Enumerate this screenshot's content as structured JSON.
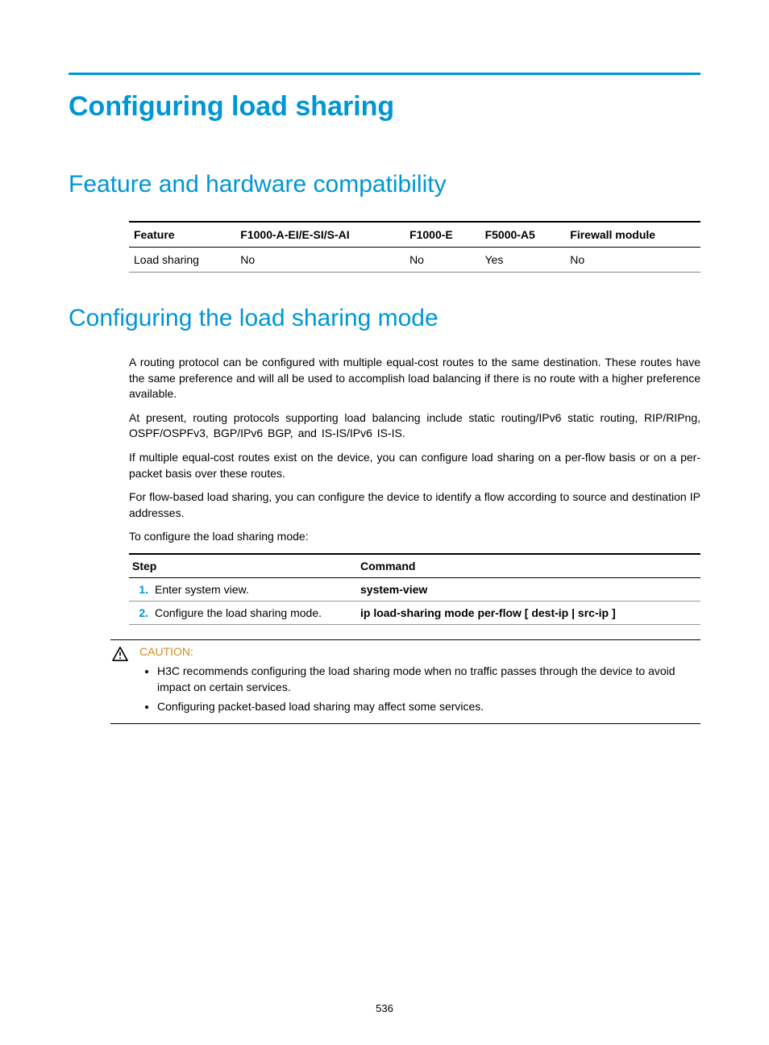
{
  "title": "Configuring load sharing",
  "section1": {
    "heading": "Feature and hardware compatibility",
    "table": {
      "headers": [
        "Feature",
        "F1000-A-EI/E-SI/S-AI",
        "F1000-E",
        "F5000-A5",
        "Firewall module"
      ],
      "row": {
        "feature": "Load sharing",
        "c1": "No",
        "c2": "No",
        "c3": "Yes",
        "c4": "No"
      }
    }
  },
  "section2": {
    "heading": "Configuring the load sharing mode",
    "p1": "A routing protocol can be configured with multiple equal-cost routes to the same destination. These routes have the same preference and will all be used to accomplish load balancing if there is no route with a higher preference available.",
    "p2": "At present, routing protocols supporting load balancing include static routing/IPv6 static routing, RIP/RIPng, OSPF/OSPFv3, BGP/IPv6 BGP, and IS-IS/IPv6 IS-IS.",
    "p3": "If multiple equal-cost routes exist on the device, you can configure load sharing on a per-flow basis or on a per-packet basis over these routes.",
    "p4": "For flow-based load sharing, you can configure the device to identify a flow according to source and destination IP addresses.",
    "p5": "To configure the load sharing mode:",
    "steps": {
      "headers": [
        "Step",
        "Command"
      ],
      "rows": [
        {
          "num": "1.",
          "text": "Enter system view.",
          "cmd": "system-view"
        },
        {
          "num": "2.",
          "text": "Configure the load sharing mode.",
          "cmd": "ip load-sharing mode per-flow [ dest-ip | src-ip ]"
        }
      ]
    },
    "caution": {
      "label": "CAUTION:",
      "items": [
        "H3C recommends configuring the load sharing mode when no traffic passes through the device to avoid impact on certain services.",
        "Configuring packet-based load sharing may affect some services."
      ]
    }
  },
  "page_number": "536"
}
